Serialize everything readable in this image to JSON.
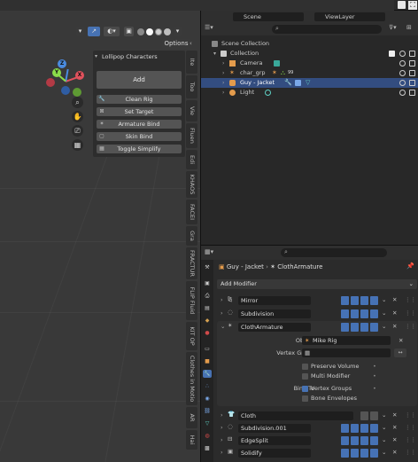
{
  "topbar": {
    "scene_label": "Scene",
    "viewlayer_label": "ViewLayer"
  },
  "viewport": {
    "options_label": "Options",
    "gizmo": {
      "x": "X",
      "y": "Y",
      "z": "Z"
    }
  },
  "npanel": {
    "title": "Lollipop Characters",
    "add_label": "Add",
    "buttons": [
      "Clean Rig",
      "Set Target",
      "Armature Bind",
      "Skin Bind",
      "Toggle Simplify"
    ]
  },
  "vtabs": [
    "Ite",
    "Too",
    "Vie",
    "Fluen",
    "Edi",
    "KHAOS",
    "FACEI",
    "Gra",
    "FRACTUR",
    "FLIP Fluid",
    "KIT OP",
    "Clothes in Motio",
    "AR",
    "Hai"
  ],
  "outliner": {
    "rows": [
      {
        "label": "Scene Collection"
      },
      {
        "label": "Collection"
      },
      {
        "label": "Camera"
      },
      {
        "label": "char_grp",
        "extra": "99"
      },
      {
        "label": "Guy - Jacket"
      },
      {
        "label": "Light"
      }
    ]
  },
  "properties": {
    "breadcrumb_object": "Guy - Jacket",
    "breadcrumb_modifier": "ClothArmature",
    "add_modifier_label": "Add Modifier",
    "modifiers": [
      "Mirror",
      "Subdivision",
      "ClothArmature"
    ],
    "cloth_armature": {
      "object_label": "Object",
      "object_value": "Mike Rig",
      "vertex_group_label": "Vertex Group",
      "preserve_volume_label": "Preserve Volume",
      "multi_modifier_label": "Multi Modifier",
      "bind_to_label": "Bind To",
      "vertex_groups_label": "Vertex Groups",
      "bone_envelopes_label": "Bone Envelopes"
    },
    "modifiers_below": [
      "Cloth",
      "Subdivision.001",
      "EdgeSplit",
      "Solidify"
    ]
  },
  "colors": {
    "accent_blue": "#4772b3",
    "selection": "#334d80",
    "axis_x": "#e0515c",
    "axis_y": "#8bdc4a",
    "axis_z": "#4a8be0"
  }
}
